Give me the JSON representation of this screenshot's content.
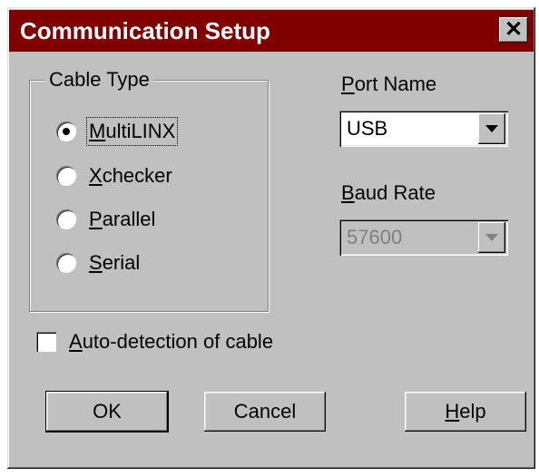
{
  "window": {
    "title": "Communication Setup",
    "close_label": "✕"
  },
  "cable_type": {
    "label": "Cable Type",
    "options": [
      {
        "pre": "",
        "accel": "M",
        "post": "ultiLINX",
        "selected": true
      },
      {
        "pre": "",
        "accel": "X",
        "post": "checker",
        "selected": false
      },
      {
        "pre": "",
        "accel": "P",
        "post": "arallel",
        "selected": false
      },
      {
        "pre": "",
        "accel": "S",
        "post": "erial",
        "selected": false
      }
    ]
  },
  "port_name": {
    "pre": "",
    "accel": "P",
    "post": "ort Name",
    "value": "USB"
  },
  "baud_rate": {
    "pre": "",
    "accel": "B",
    "post": "aud Rate",
    "value": "57600",
    "disabled": true
  },
  "auto_detect": {
    "pre": "",
    "accel": "A",
    "post": "uto-detection of cable",
    "checked": false
  },
  "buttons": {
    "ok": "OK",
    "cancel": "Cancel",
    "help": {
      "pre": "",
      "accel": "H",
      "post": "elp"
    }
  },
  "colors": {
    "titlebar": "#800000",
    "face": "#c0c0c0"
  }
}
